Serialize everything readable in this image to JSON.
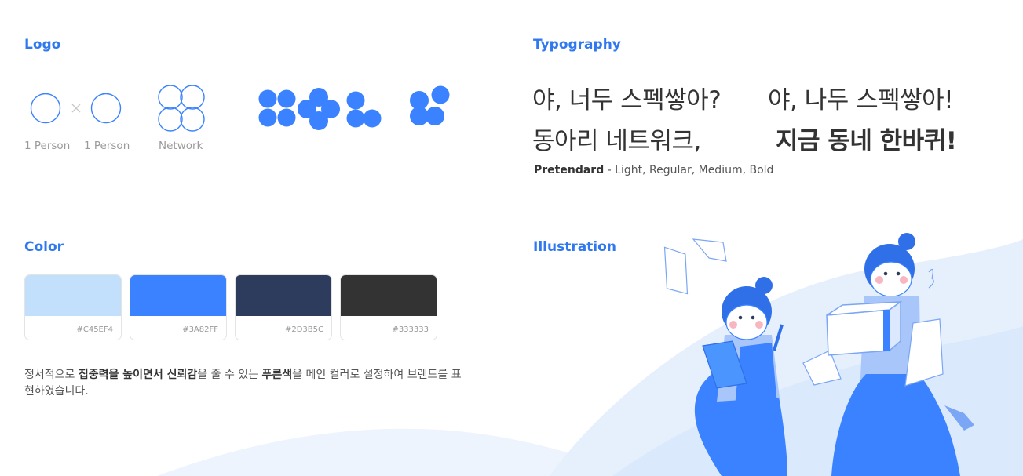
{
  "logo": {
    "title": "Logo",
    "labels": [
      "1 Person",
      "1 Person",
      "Network"
    ]
  },
  "typography": {
    "title": "Typography",
    "line1_left": "야, 너두 스펙쌓아?",
    "line1_right": "야, 나두 스펙쌓아!",
    "line2_left": "동아리 네트워크,",
    "line2_right": "지금 동네 한바퀴!",
    "font_name": "Pretendard",
    "font_weights": "- Light, Regular, Medium, Bold"
  },
  "color": {
    "title": "Color",
    "swatches": [
      {
        "hex": "#C45EF4",
        "color": "#c2e0fb"
      },
      {
        "hex": "#3A82FF",
        "color": "#3a82ff"
      },
      {
        "hex": "#2D3B5C",
        "color": "#2d3b5c"
      },
      {
        "hex": "#333333",
        "color": "#333333"
      }
    ],
    "description": {
      "p1": "정서적으로 ",
      "b1": "집중력을 높이면서 신뢰감",
      "p2": "을 줄 수 있는 ",
      "b2": "푸른색",
      "p3": "을 메인 컬러로 설정하여 브랜드를 표현하였습니다."
    }
  },
  "illustration": {
    "title": "Illustration"
  },
  "icons": {
    "multiply": "times-icon",
    "network": "network-icon",
    "brand_marks": "flower-logo-icons"
  }
}
